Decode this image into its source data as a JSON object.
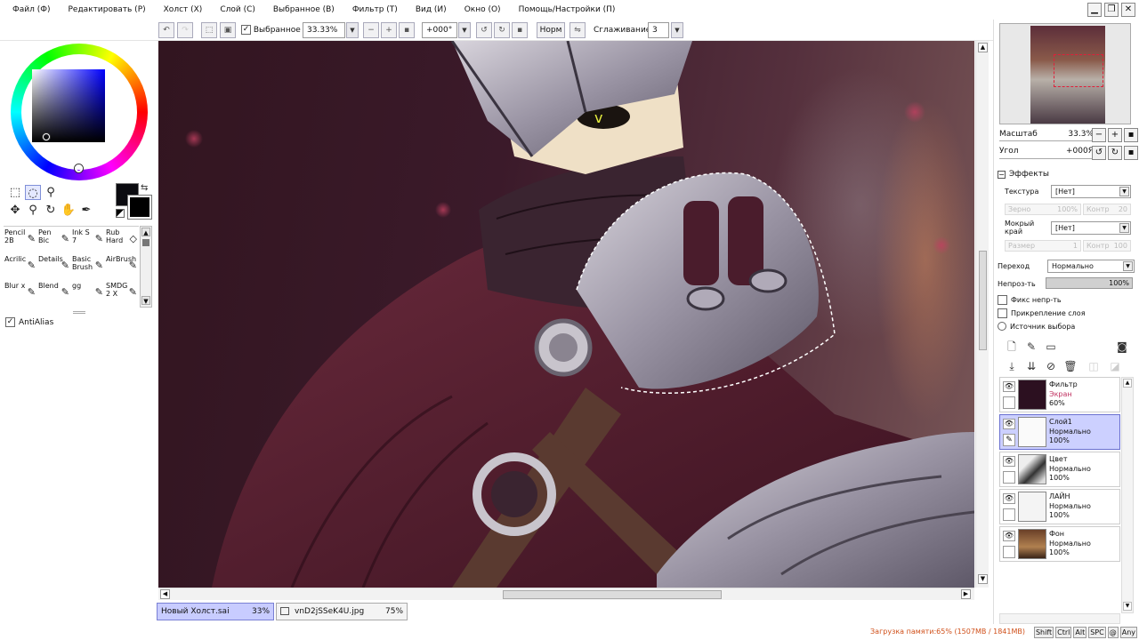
{
  "menu": [
    "Файл (Ф)",
    "Редактировать (Р)",
    "Холст (Х)",
    "Слой (С)",
    "Выбранное (В)",
    "Фильтр (Т)",
    "Вид (И)",
    "Окно (О)",
    "Помощь/Настройки (П)"
  ],
  "window_buttons": [
    "▁",
    "❐",
    "✕"
  ],
  "toolbar": {
    "selection_label": "Выбранное",
    "zoom_value": "33.33%",
    "rotation_value": "+000°",
    "mode_button": "Норм",
    "smoothing_label": "Сглаживание",
    "smoothing_value": "3"
  },
  "color_modes": [
    "◎",
    "☰",
    "☷",
    "▤",
    "▦",
    "◘"
  ],
  "brushes": [
    {
      "name": "Pencil 2B",
      "icon": "✎"
    },
    {
      "name": "Pen Bic",
      "icon": "✎"
    },
    {
      "name": "Ink S 7",
      "icon": "✎"
    },
    {
      "name": "Rub Hard",
      "icon": "◇"
    },
    {
      "name": "Acrilic",
      "icon": "✎"
    },
    {
      "name": "Details",
      "icon": "✎"
    },
    {
      "name": "Basic Brush",
      "icon": "✎"
    },
    {
      "name": "AirBrush",
      "icon": "✎"
    },
    {
      "name": "Blur x",
      "icon": "✎"
    },
    {
      "name": "Blend",
      "icon": "✎"
    },
    {
      "name": "gg",
      "icon": "✎"
    },
    {
      "name": "SMDG 2 X",
      "icon": "✎"
    }
  ],
  "antialias_label": "AntiAlias",
  "documents": [
    {
      "name": "Новый Холст.sai",
      "zoom": "33%"
    },
    {
      "name": "vnD2jSSeK4U.jpg",
      "zoom": "75%"
    }
  ],
  "status": {
    "memory": "Загрузка памяти:65% (1507MB / 1841MB)",
    "keys": [
      "Shift",
      "Ctrl",
      "Alt",
      "SPC",
      "@",
      "Any"
    ]
  },
  "navigator": {
    "zoom_label": "Масштаб",
    "zoom_value": "33.3%",
    "angle_label": "Угол",
    "angle_value": "+000Я"
  },
  "effects": {
    "title": "Эффекты",
    "texture_label": "Текстура",
    "texture_value": "[Нет]",
    "grain_label": "Зерно",
    "grain_value": "100%",
    "contrast_label": "Контр",
    "contrast_value": "20",
    "wet_edge_label": "Мокрый край",
    "wet_edge_value": "[Нет]",
    "size_label": "Размер",
    "size_value": "1",
    "contrast2_value": "100"
  },
  "layer_props": {
    "blend_label": "Переход",
    "blend_value": "Нормально",
    "opacity_label": "Непроз-ть",
    "opacity_value": "100%",
    "options": [
      "Фикс непр-ть",
      "Прикрепление слоя",
      "Источник выбора"
    ]
  },
  "layers": [
    {
      "name": "Фильтр",
      "mode": "Экран",
      "opacity": "60%",
      "thumb": "#2c1020"
    },
    {
      "name": "Слой1",
      "mode": "Нормально",
      "opacity": "100%",
      "thumb": "#fafafa"
    },
    {
      "name": "Цвет",
      "mode": "Нормально",
      "opacity": "100%",
      "thumb": "#cfcfcf"
    },
    {
      "name": "ЛАЙН",
      "mode": "Нормально",
      "opacity": "100%",
      "thumb": "#f4f4f4"
    },
    {
      "name": "Фон",
      "mode": "Нормально",
      "opacity": "100%",
      "thumb": "#8a6038"
    }
  ],
  "colors": {
    "accent": "#6a70d0",
    "memory_warning": "#d0501a",
    "selection_tab": "#c8ccff"
  }
}
